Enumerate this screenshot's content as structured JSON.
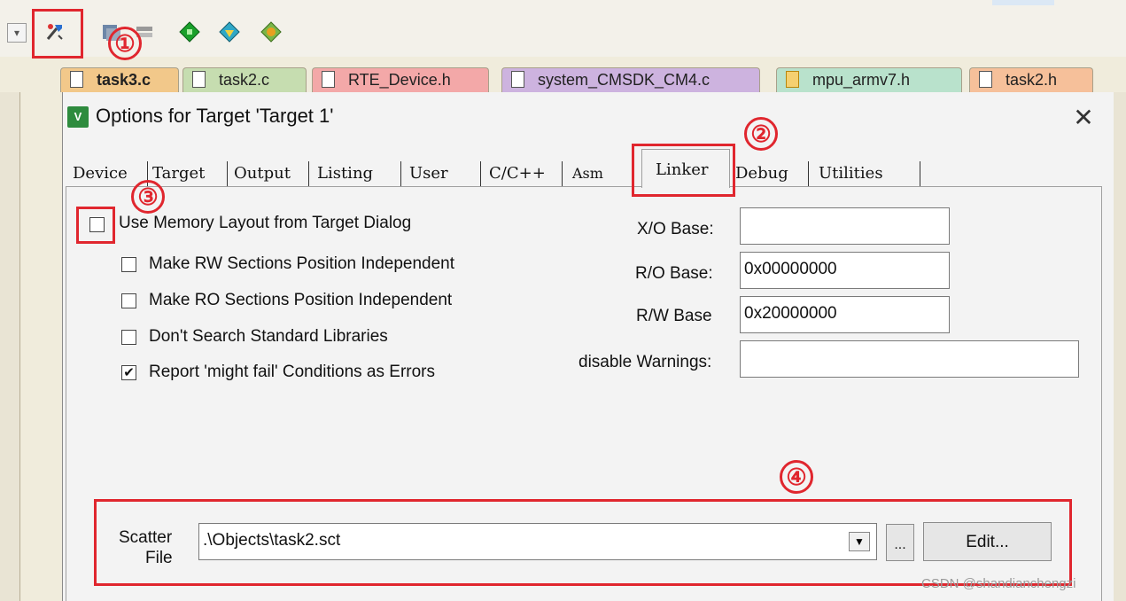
{
  "toolbar": {
    "icons": [
      "target-options-icon",
      "build-icon",
      "batch-icon",
      "download-icon",
      "debug-icon",
      "pack-icon"
    ]
  },
  "file_tabs": [
    {
      "label": "task3.c",
      "color": "#f2c88a",
      "active": true
    },
    {
      "label": "task2.c",
      "color": "#c6ddb0",
      "active": false
    },
    {
      "label": "RTE_Device.h",
      "color": "#f3a8a8",
      "active": false
    },
    {
      "label": "system_CMSDK_CM4.c",
      "color": "#cdb3df",
      "active": false
    },
    {
      "label": "mpu_armv7.h",
      "color": "#b9e2cc",
      "active": false
    },
    {
      "label": "task2.h",
      "color": "#f6c09a",
      "active": false
    }
  ],
  "dialog": {
    "title": "Options for Target 'Target 1'",
    "close": "✕",
    "tabs": [
      "Device",
      "Target",
      "Output",
      "Listing",
      "User",
      "C/C++",
      "Asm",
      "Linker",
      "Debug",
      "Utilities"
    ],
    "active_tab": "Linker",
    "options": {
      "use_memory_layout": {
        "label": "Use Memory Layout from Target Dialog",
        "checked": false
      },
      "rw_independent": {
        "label": "Make RW Sections Position Independent",
        "checked": false
      },
      "ro_independent": {
        "label": "Make RO Sections Position Independent",
        "checked": false
      },
      "dont_search_libs": {
        "label": "Don't Search Standard Libraries",
        "checked": false
      },
      "report_might_fail": {
        "label": "Report 'might fail' Conditions as Errors",
        "checked": true
      }
    },
    "fields": {
      "xo_base": {
        "label": "X/O Base:",
        "value": ""
      },
      "ro_base": {
        "label": "R/O Base:",
        "value": "0x00000000"
      },
      "rw_base": {
        "label": "R/W Base",
        "value": "0x20000000"
      },
      "disable_warnings": {
        "label": "disable Warnings:",
        "value": ""
      }
    },
    "scatter": {
      "label_line1": "Scatter",
      "label_line2": "File",
      "value": ".\\Objects\\task2.sct",
      "browse": "...",
      "edit": "Edit..."
    }
  },
  "annotations": [
    "①",
    "②",
    "③",
    "④"
  ],
  "annotation_color": "#e0262e",
  "watermark": "CSDN @shandianchengzi"
}
